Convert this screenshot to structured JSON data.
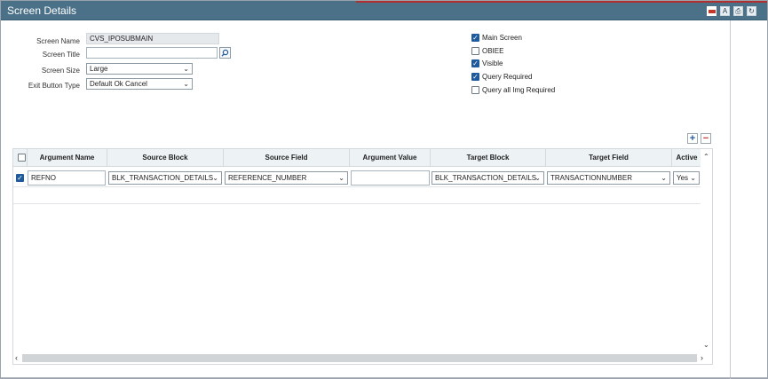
{
  "window": {
    "title": "Screen Details"
  },
  "form": {
    "screen_name_label": "Screen Name",
    "screen_name_value": "CVS_IPOSUBMAIN",
    "screen_title_label": "Screen Title",
    "screen_title_value": "",
    "screen_size_label": "Screen Size",
    "screen_size_value": "Large",
    "exit_button_label": "Exit Button Type",
    "exit_button_value": "Default Ok Cancel"
  },
  "options": [
    {
      "label": "Main Screen",
      "checked": true
    },
    {
      "label": "OBIEE",
      "checked": false
    },
    {
      "label": "Visible",
      "checked": true
    },
    {
      "label": "Query Required",
      "checked": true
    },
    {
      "label": "Query all Img Required",
      "checked": false
    }
  ],
  "grid": {
    "columns": [
      "Argument Name",
      "Source Block",
      "Source Field",
      "Argument Value",
      "Target Block",
      "Target Field",
      "Active"
    ],
    "rows": [
      {
        "selected": true,
        "argument_name": "REFNO",
        "source_block": "BLK_TRANSACTION_DETAILS",
        "source_field": "REFERENCE_NUMBER",
        "argument_value": "",
        "target_block": "BLK_TRANSACTION_DETAILS",
        "target_field": "TRANSACTIONNUMBER",
        "active": "Yes"
      }
    ]
  },
  "icons": {
    "title_actions": [
      "minimize-icon",
      "font-icon",
      "print-icon",
      "refresh-icon"
    ],
    "accent": "#4a7187",
    "check_color": "#1f5a9c",
    "add_color": "#1f5a9c",
    "delete_color": "#c0392b"
  }
}
